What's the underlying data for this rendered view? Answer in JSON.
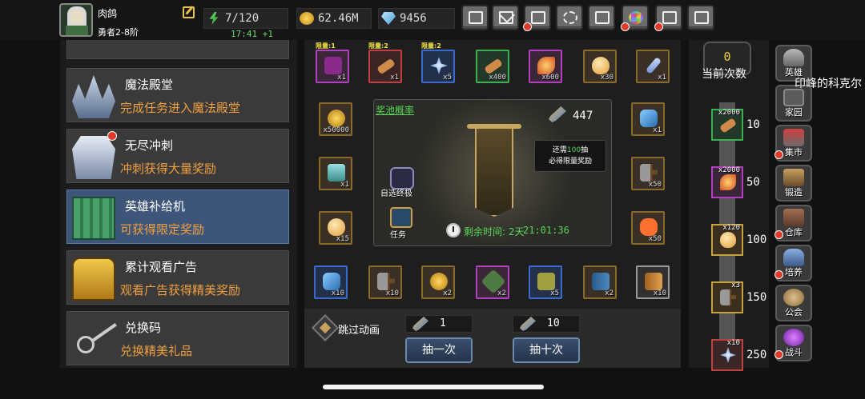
{
  "player": {
    "name": "肉鸽",
    "rank": "勇者2-8阶"
  },
  "resources": {
    "energy": "7/120",
    "energy_timer": "17:41 +1",
    "gold": "62.46M",
    "gems": "9456"
  },
  "top_buttons": [
    {
      "icon": "shop-cart-icon",
      "alert": false
    },
    {
      "icon": "mail-icon",
      "alert": false
    },
    {
      "icon": "gamepad-icon",
      "alert": true
    },
    {
      "icon": "gear-icon",
      "alert": false
    },
    {
      "icon": "gift-icon",
      "alert": false
    },
    {
      "icon": "color-wheel-icon",
      "alert": true
    },
    {
      "icon": "burst-icon",
      "alert": true
    },
    {
      "icon": "crossed-swords-icon",
      "alert": false
    }
  ],
  "left_menu": [
    {
      "title": "魔法殿堂",
      "desc": "完成任务进入魔法殿堂",
      "icon": "crystal-crown-icon",
      "selected": false,
      "alert": false
    },
    {
      "title": "无尽冲刺",
      "desc": "冲刺获得大量奖励",
      "icon": "winged-armor-icon",
      "selected": false,
      "alert": true
    },
    {
      "title": "英雄补给机",
      "desc": "可获得限定奖励",
      "icon": "supply-block-icon",
      "selected": true,
      "alert": false
    },
    {
      "title": "累计观看广告",
      "desc": "观看广告获得精美奖励",
      "icon": "treasure-chest-icon",
      "selected": false,
      "alert": false
    },
    {
      "title": "兑换码",
      "desc": "兑换精美礼品",
      "icon": "key-icon",
      "selected": false,
      "alert": false
    }
  ],
  "rewards_top": [
    {
      "qty": "x1",
      "limit": "限量:1",
      "icon": "purple-scroll-icon"
    },
    {
      "qty": "x1",
      "limit": "限量:2",
      "icon": "bone-icon"
    },
    {
      "qty": "x5",
      "limit": "限量:2",
      "icon": "star-orb-icon"
    },
    {
      "qty": "x400",
      "limit": "",
      "icon": "bone-icon"
    },
    {
      "qty": "x600",
      "limit": "",
      "icon": "fire-shard-icon"
    },
    {
      "qty": "x30",
      "limit": "",
      "icon": "egg-icon"
    },
    {
      "qty": "x1",
      "limit": "",
      "icon": "feather-icon"
    }
  ],
  "rewards_left": [
    {
      "qty": "x50000",
      "icon": "gold-coin-icon"
    },
    {
      "qty": "x1",
      "icon": "treasure-chest-icon"
    },
    {
      "qty": "x15",
      "icon": "egg-icon"
    }
  ],
  "rewards_right": [
    {
      "qty": "x1",
      "icon": "gem-card-icon"
    },
    {
      "qty": "x50",
      "icon": "hammer-icon"
    },
    {
      "qty": "x50",
      "icon": "flame-icon"
    }
  ],
  "rewards_bottom": [
    {
      "qty": "x10",
      "icon": "blue-rune-icon"
    },
    {
      "qty": "x10",
      "icon": "hammer-icon"
    },
    {
      "qty": "x2",
      "icon": "gold-coin-icon"
    },
    {
      "qty": "x2",
      "icon": "green-rune-icon"
    },
    {
      "qty": "x5",
      "icon": "blue-rune-icon"
    },
    {
      "qty": "x2",
      "icon": "spell-book-icon"
    },
    {
      "qty": "x10",
      "icon": "brown-book-icon"
    }
  ],
  "pool": {
    "title": "奖池概率",
    "count": "447",
    "tooltip_pre": "还需",
    "tooltip_num": "100",
    "tooltip_post": "抽",
    "tooltip_line2": "必得限量奖励",
    "npc1": "自选终极",
    "npc2": "任务",
    "remain_label": "剩余时间: 2天",
    "remain_time": "21:01:36"
  },
  "controls": {
    "skip_label": "跳过动画",
    "cost_single": "1",
    "cost_ten": "10",
    "draw_one": "抽一次",
    "draw_ten": "抽十次"
  },
  "progress": {
    "current": "0",
    "label": "当前次数",
    "milestones": [
      {
        "n": "10",
        "qty": "x2000",
        "icon": "bone-icon",
        "color": "grn"
      },
      {
        "n": "50",
        "qty": "x2000",
        "icon": "fire-shard-icon",
        "color": "pur"
      },
      {
        "n": "100",
        "qty": "x120",
        "icon": "egg-icon",
        "color": "gold"
      },
      {
        "n": "150",
        "qty": "x3",
        "icon": "wand-icon",
        "color": "gold"
      },
      {
        "n": "250",
        "qty": "x10",
        "icon": "star-orb-icon",
        "color": "red"
      }
    ]
  },
  "right_nav": [
    {
      "label": "英雄",
      "icon": "helmet-icon",
      "alert": false
    },
    {
      "label": "家园",
      "icon": "castle-icon",
      "alert": false
    },
    {
      "label": "集市",
      "icon": "market-icon",
      "alert": true
    },
    {
      "label": "锻造",
      "icon": "anvil-icon",
      "alert": false
    },
    {
      "label": "仓库",
      "icon": "warehouse-icon",
      "alert": true
    },
    {
      "label": "培养",
      "icon": "trophy-icon",
      "alert": true
    },
    {
      "label": "公会",
      "icon": "guild-icon",
      "alert": false
    },
    {
      "label": "战斗",
      "icon": "portal-icon",
      "alert": true
    }
  ],
  "overflow_text": "印峰的科克尔"
}
